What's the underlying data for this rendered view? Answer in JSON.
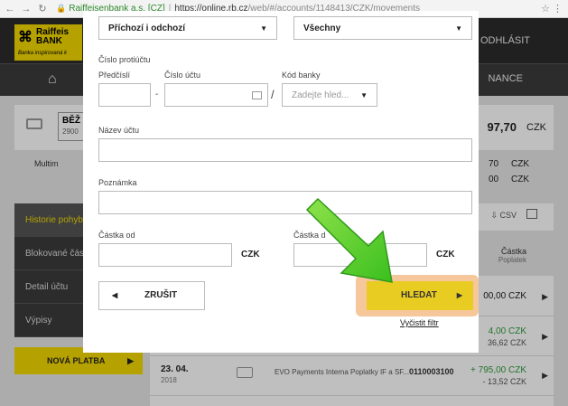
{
  "browser": {
    "site_name": "Raiffeisenbank a.s. [CZ]",
    "url_host": "https://online.rb.cz",
    "url_path": "/web/#/accounts/1148413/CZK/movements"
  },
  "header": {
    "logo_mark": "⌘",
    "logo_line1": "Raiffeis",
    "logo_line2": "BANK",
    "logo_tagline": "Banka inspirovaná k",
    "logout": "ODHLÁSIT",
    "nav_finance": "NANCE"
  },
  "account": {
    "name_short": "BĚŽ",
    "number_short": "2900",
    "balance_partial": "97,70",
    "currency": "CZK",
    "multi_label": "Multim",
    "sub_amounts": [
      {
        "value": "70",
        "currency": "CZK"
      },
      {
        "value": "00",
        "currency": "CZK"
      }
    ]
  },
  "sidebar": {
    "items": [
      {
        "label": "Historie pohyb"
      },
      {
        "label": "Blokované čásť"
      },
      {
        "label": "Detail účtu"
      },
      {
        "label": "Výpisy"
      }
    ],
    "new_payment": "NOVÁ PLATBA"
  },
  "list": {
    "csv_label": "CSV",
    "col_amount": "Částka",
    "col_fees": "Poplatek",
    "row1_amount": "00,00 CZK",
    "row2_amount": "4,00 CZK",
    "row2_fee": "36,62 CZK",
    "last_row": {
      "date": "23. 04.",
      "year": "2018",
      "merchant": "EVO Payments Interna Poplatky IF a SF...",
      "account": "0110003100",
      "amount": "+ 795,00 CZK",
      "fee": "- 13,52 CZK"
    }
  },
  "filter": {
    "direction_value": "Příchozí i odchozí",
    "type_value": "Všechny",
    "counter_account_label": "Číslo protiúčtu",
    "prefix_label": "Předčíslí",
    "account_no_label": "Číslo účtu",
    "bank_code_label": "Kód banky",
    "bank_code_placeholder": "Zadejte hled...",
    "account_name_label": "Název účtu",
    "note_label": "Poznámka",
    "amount_from_label": "Částka od",
    "amount_to_label": "Částka d",
    "currency": "CZK",
    "cancel_label": "ZRUŠIT",
    "search_label": "HLEDAT",
    "clear_label": "Vyčistit filtr"
  },
  "colors": {
    "brand_yellow": "#f2d900",
    "highlight_orange": "#f6c79b",
    "arrow_green": "#6cd42c",
    "positive_amount": "#2e9b3b"
  }
}
